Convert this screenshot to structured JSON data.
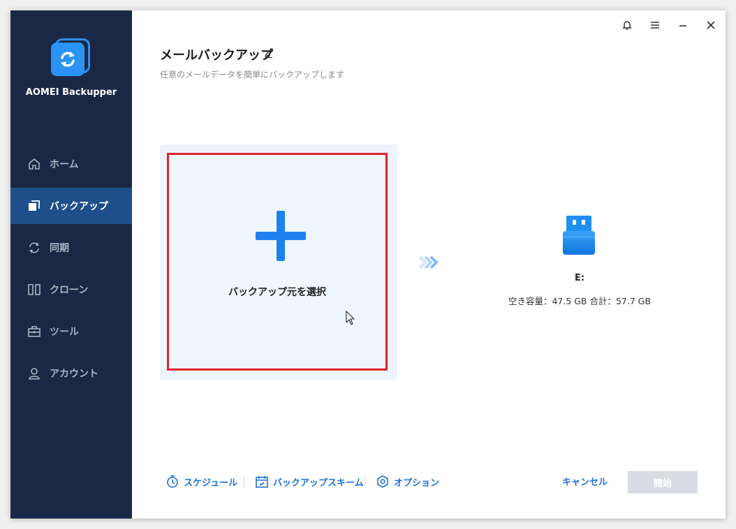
{
  "app": {
    "name": "AOMEI Backupper"
  },
  "sidebar": {
    "items": [
      {
        "label": "ホーム",
        "icon": "home-icon",
        "active": false
      },
      {
        "label": "バックアップ",
        "icon": "backup-icon",
        "active": true
      },
      {
        "label": "同期",
        "icon": "sync-icon",
        "active": false
      },
      {
        "label": "クローン",
        "icon": "clone-icon",
        "active": false
      },
      {
        "label": "ツール",
        "icon": "toolbox-icon",
        "active": false
      },
      {
        "label": "アカウント",
        "icon": "user-icon",
        "active": false
      }
    ]
  },
  "header": {
    "title": "メールバックアップ",
    "subtitle": "任意のメールデータを簡単にバックアップします"
  },
  "source": {
    "label": "バックアップ元を選択"
  },
  "target": {
    "drive": "E:",
    "info": "空き容量：47.5 GB 合計：57.7 GB"
  },
  "footer": {
    "schedule": "スケジュール",
    "scheme": "バックアップスキーム",
    "options": "オプション",
    "cancel": "キャンセル",
    "start": "開始"
  },
  "colors": {
    "sidebar_bg": "#1a2845",
    "active_item": "#1f4f8b",
    "accent": "#1e82ee",
    "highlight_border": "#e0232b"
  }
}
